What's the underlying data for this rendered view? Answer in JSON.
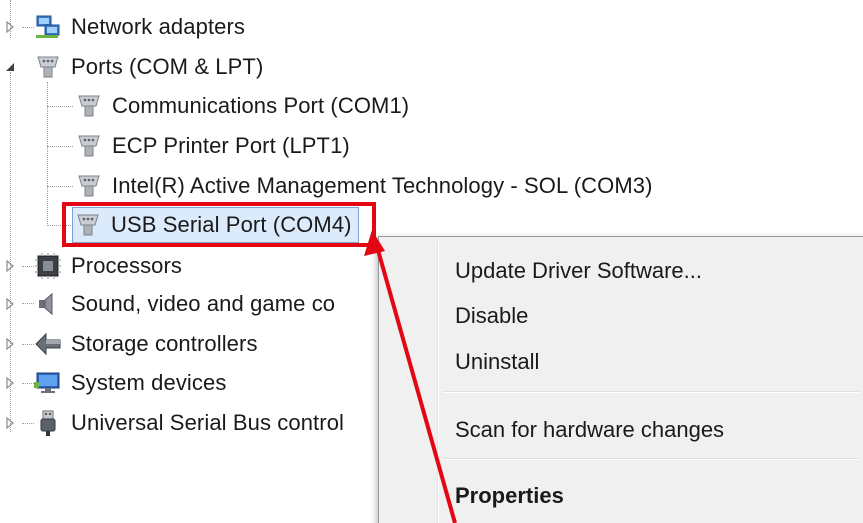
{
  "tree": {
    "network_adapters": {
      "label": "Network adapters",
      "icon": "network-adapter-icon",
      "state": "collapsed"
    },
    "ports": {
      "label": "Ports (COM & LPT)",
      "icon": "port-connector-icon",
      "state": "expanded"
    },
    "ports_children": [
      {
        "label": "Communications Port (COM1)",
        "icon": "port-connector-icon"
      },
      {
        "label": "ECP Printer Port (LPT1)",
        "icon": "port-connector-icon"
      },
      {
        "label": "Intel(R) Active Management Technology - SOL (COM3)",
        "icon": "port-connector-icon"
      },
      {
        "label": "USB Serial Port (COM4)",
        "icon": "port-connector-icon",
        "selected": true
      }
    ],
    "processors": {
      "label": "Processors",
      "icon": "cpu-chip-icon",
      "state": "collapsed"
    },
    "sound": {
      "label": "Sound, video and game co",
      "icon": "speaker-icon",
      "state": "collapsed"
    },
    "storage": {
      "label": "Storage controllers",
      "icon": "storage-controller-icon",
      "state": "collapsed"
    },
    "system": {
      "label": "System devices",
      "icon": "monitor-icon",
      "state": "collapsed"
    },
    "usb": {
      "label": "Universal Serial Bus control",
      "icon": "usb-plug-icon",
      "state": "collapsed"
    }
  },
  "context_menu": {
    "update_driver": "Update Driver Software...",
    "disable": "Disable",
    "uninstall": "Uninstall",
    "scan": "Scan for hardware changes",
    "properties": "Properties"
  },
  "annotation": {
    "color": "#e30613"
  },
  "colors": {
    "selection_fill": "#dcebfc",
    "selection_border": "#7da2ce",
    "menu_background": "#f0f0f0"
  }
}
